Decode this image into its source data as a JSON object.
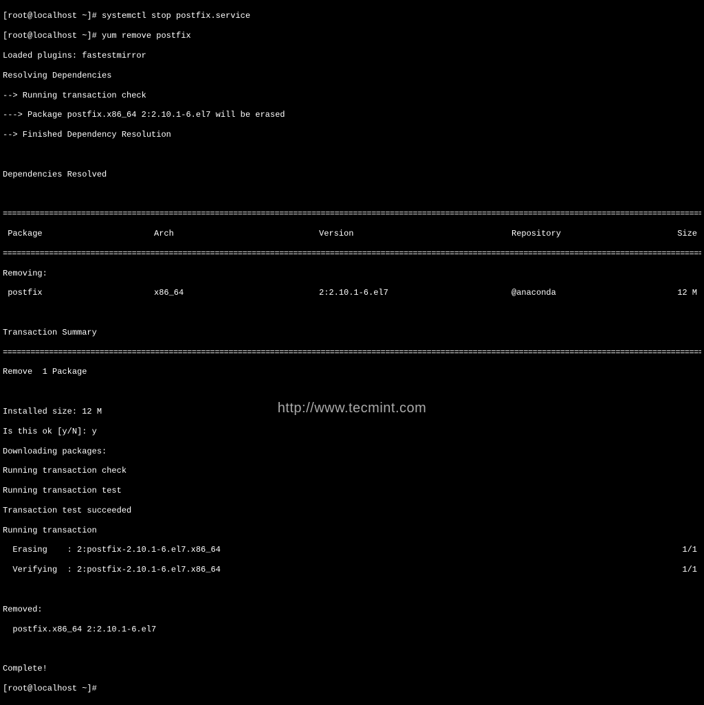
{
  "prompts": {
    "p1": "[root@localhost ~]# ",
    "p2": "[root@localhost ~]# ",
    "p3": "[root@localhost ~]# "
  },
  "commands": {
    "cmd1": "systemctl stop postfix.service",
    "cmd2": "yum remove postfix"
  },
  "output": {
    "loaded_plugins": "Loaded plugins: fastestmirror",
    "resolving": "Resolving Dependencies",
    "running_check": "--> Running transaction check",
    "package_erased": "---> Package postfix.x86_64 2:2.10.1-6.el7 will be erased",
    "finished_dep": "--> Finished Dependency Resolution",
    "deps_resolved": "Dependencies Resolved",
    "separator": "================================================================================================================================================================================",
    "table_header": {
      "package": " Package",
      "arch": "Arch",
      "version": "Version",
      "repo": "Repository",
      "size": "Size"
    },
    "removing_label": "Removing:",
    "table_row": {
      "package": " postfix",
      "arch": "x86_64",
      "version": "2:2.10.1-6.el7",
      "repo": "@anaconda",
      "size": "12 M"
    },
    "trans_summary": "Transaction Summary",
    "remove_count": "Remove  1 Package",
    "installed_size": "Installed size: 12 M",
    "is_ok": "Is this ok [y/N]: y",
    "downloading": "Downloading packages:",
    "run_trans_check": "Running transaction check",
    "run_trans_test": "Running transaction test",
    "trans_test_ok": "Transaction test succeeded",
    "run_trans": "Running transaction",
    "erasing": "  Erasing    : 2:postfix-2.10.1-6.el7.x86_64",
    "erasing_prog": "1/1",
    "verifying": "  Verifying  : 2:postfix-2.10.1-6.el7.x86_64",
    "verifying_prog": "1/1",
    "removed": "Removed:",
    "removed_pkg": "  postfix.x86_64 2:2.10.1-6.el7",
    "complete": "Complete!"
  },
  "watermark": "http://www.tecmint.com"
}
